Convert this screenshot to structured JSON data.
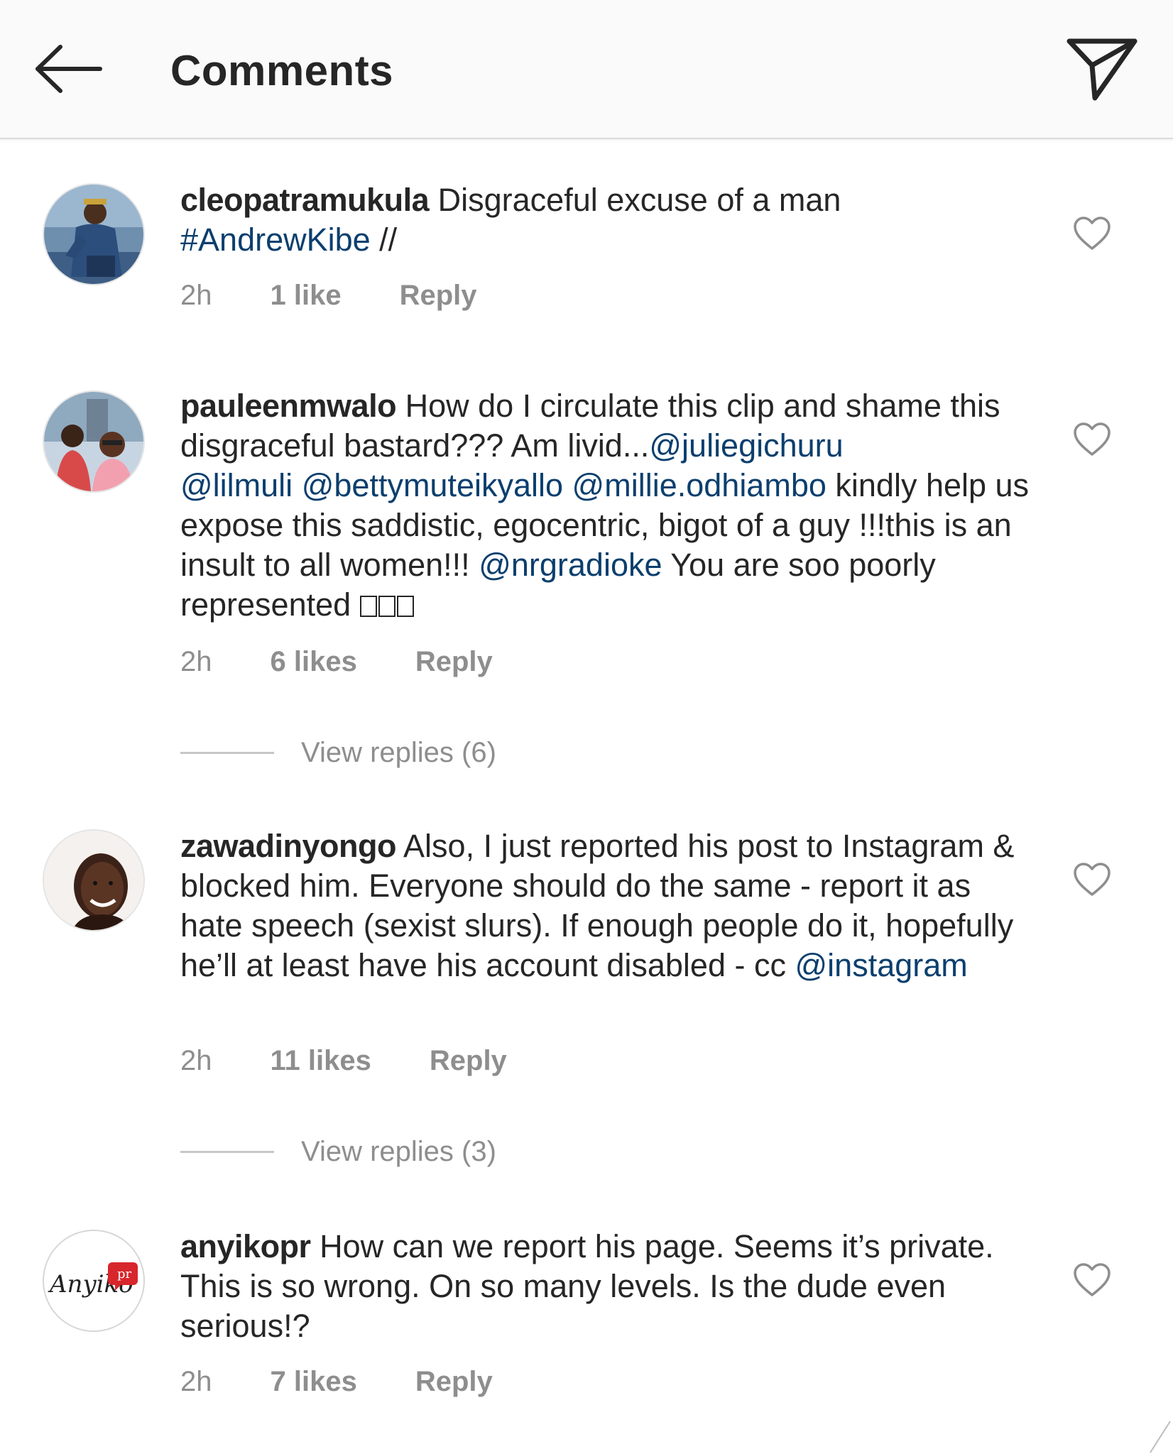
{
  "header": {
    "title": "Comments",
    "back_icon": "arrow-left-icon",
    "send_icon": "paper-plane-icon"
  },
  "colors": {
    "header_bg": "#fafafa",
    "text": "#262626",
    "mention": "#0b3f6e",
    "meta": "#8e8e8e"
  },
  "comments": [
    {
      "username": "cleopatramukula",
      "segments": [
        {
          "text": " Disgraceful excuse of a man",
          "type": "text"
        },
        {
          "text": "#AndrewKibe",
          "type": "mention",
          "break_before": true
        },
        {
          "text": " //",
          "type": "text"
        }
      ],
      "time": "2h",
      "likes": "1 like",
      "reply": "Reply"
    },
    {
      "username": "pauleenmwalo",
      "segments": [
        {
          "text": " How do I circulate this clip and shame this disgraceful bastard??? Am livid...",
          "type": "text"
        },
        {
          "text": "@juliegichuru",
          "type": "mention"
        },
        {
          "text": " ",
          "type": "text"
        },
        {
          "text": "@lilmuli",
          "type": "mention"
        },
        {
          "text": " ",
          "type": "text"
        },
        {
          "text": "@bettymuteikyallo",
          "type": "mention"
        },
        {
          "text": " ",
          "type": "text"
        },
        {
          "text": "@millie.odhiambo",
          "type": "mention"
        },
        {
          "text": " kindly help us expose this saddistic, egocentric, bigot of a guy !!!this is an insult to all women!!! ",
          "type": "text"
        },
        {
          "text": "@nrgradioke",
          "type": "mention"
        },
        {
          "text": " You are soo poorly represented ",
          "type": "text"
        }
      ],
      "emoji_count": 3,
      "time": "2h",
      "likes": "6 likes",
      "reply": "Reply",
      "view_replies": "View replies (6)"
    },
    {
      "username": "zawadinyongo",
      "segments": [
        {
          "text": " Also, I just reported his post to Instagram & blocked him. Everyone should do the same - report it as hate speech (sexist slurs). If enough people do it, hopefully he’ll at least have his account disabled - cc ",
          "type": "text"
        },
        {
          "text": "@instagram",
          "type": "mention"
        }
      ],
      "time": "2h",
      "likes": "11 likes",
      "reply": "Reply",
      "view_replies": "View replies (3)"
    },
    {
      "username": "anyikopr",
      "segments": [
        {
          "text": " How can we report his page. Seems it’s private. This is so wrong. On so many levels. Is the dude even serious!?",
          "type": "text"
        }
      ],
      "time": "2h",
      "likes": "7 likes",
      "reply": "Reply",
      "avatar_logo_text": "Anyiko",
      "avatar_logo_badge": "pr"
    }
  ]
}
